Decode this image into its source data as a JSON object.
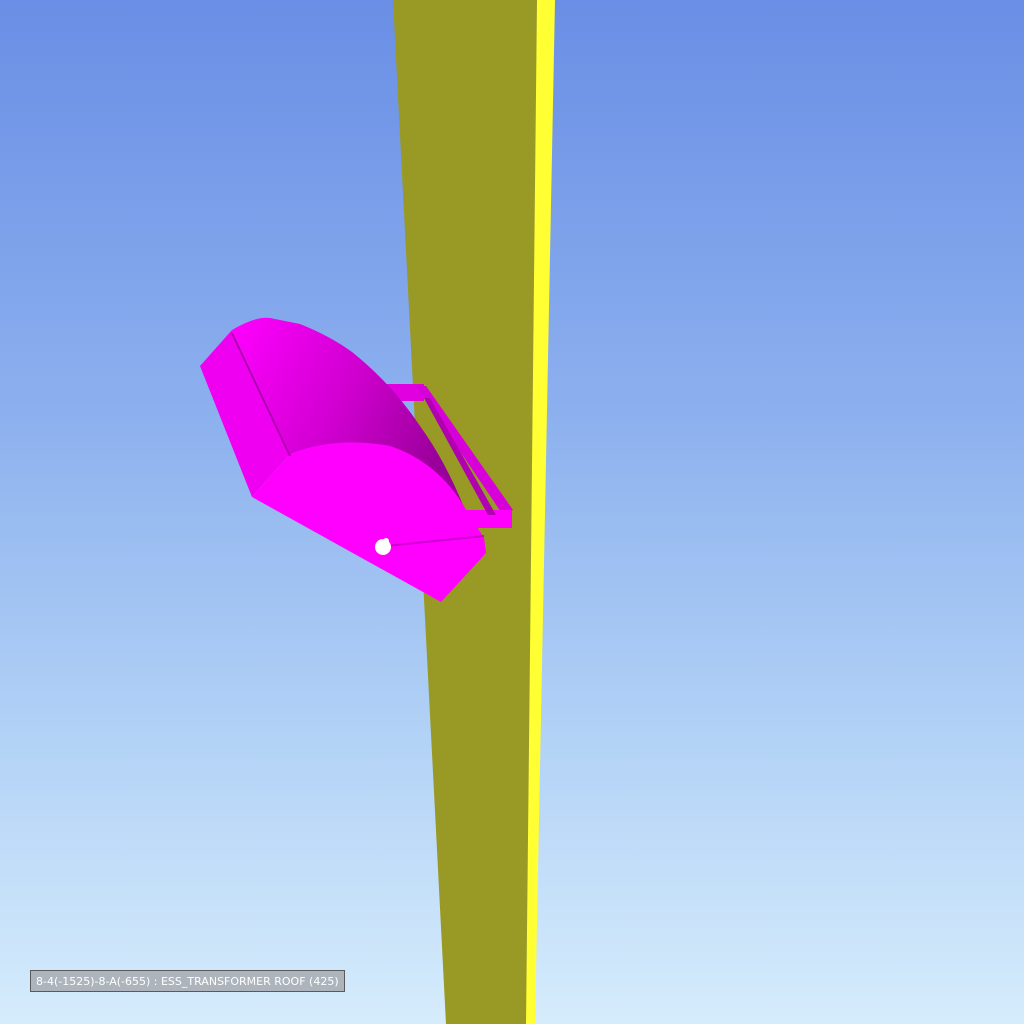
{
  "viewport": {
    "background_top": "#6a8ee5",
    "background_bottom": "#d6ecfc"
  },
  "scene": {
    "column_color": "#999926",
    "column_edge_color": "#ffff33",
    "equipment_color": "#ff00ff",
    "equipment_shadow_color": "#c000c0",
    "bolt_color": "#ffffff"
  },
  "status_label": {
    "text": "8-4(-1525)-8-A(-655) : ESS_TRANSFORMER ROOF (425)"
  }
}
